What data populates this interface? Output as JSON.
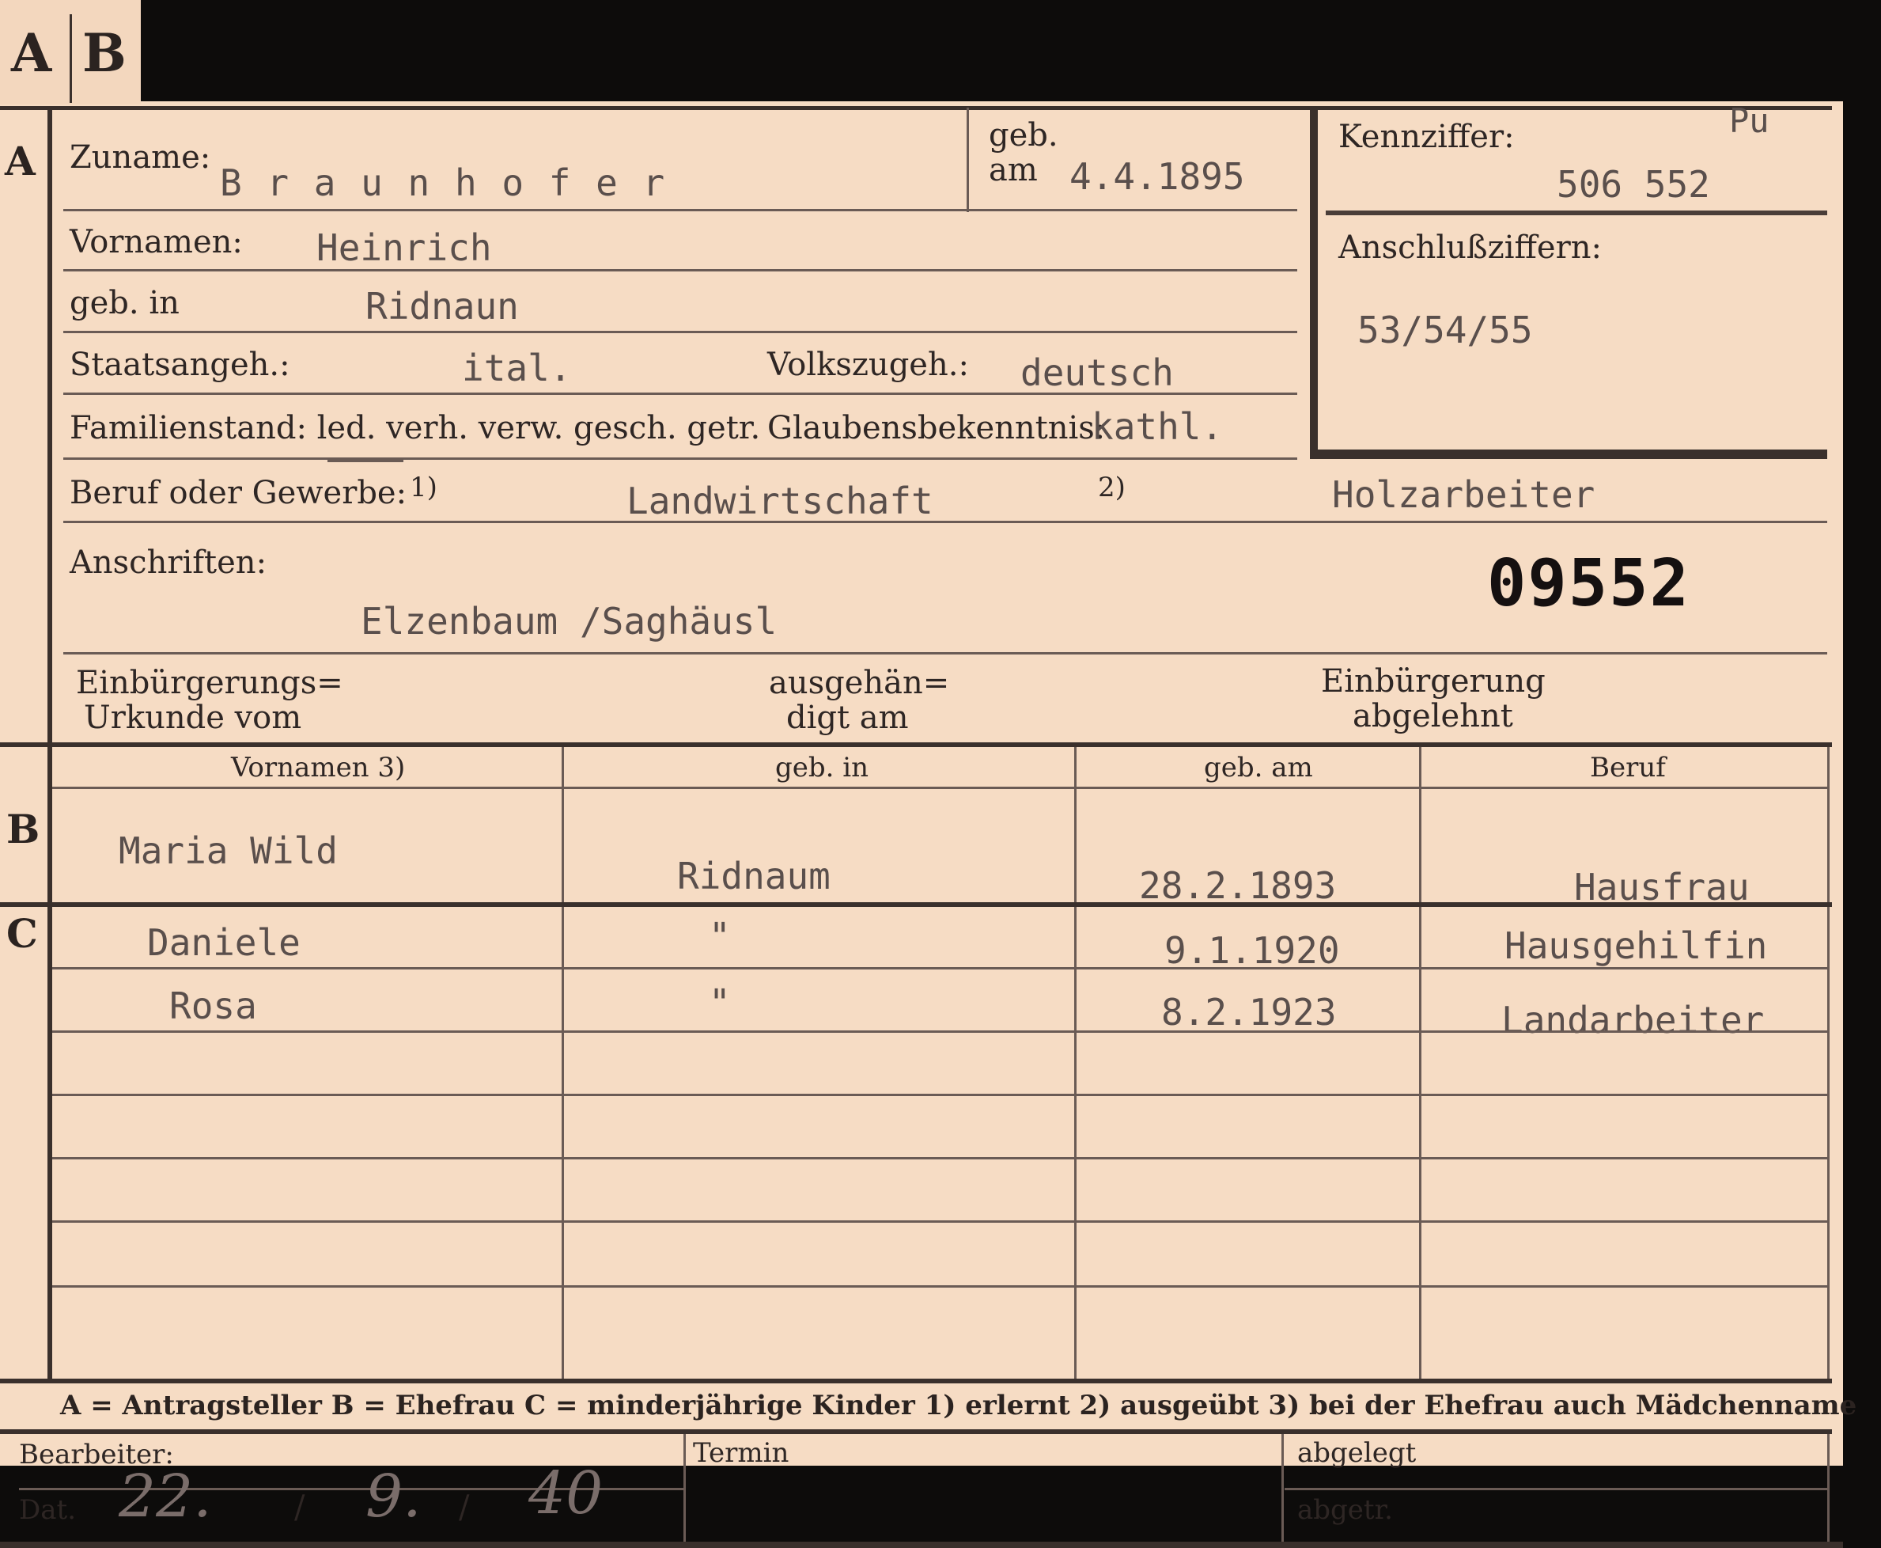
{
  "tabs": [
    "A",
    "B"
  ],
  "sections": {
    "a": "A",
    "b": "B",
    "c": "C"
  },
  "labels": {
    "surname": "Zuname:",
    "born_on_1": "geb.",
    "born_on_2": "am",
    "first_names": "Vornamen:",
    "born_in": "geb. in",
    "citizenship": "Staatsangeh.:",
    "ethnicity": "Volkszugeh.:",
    "marital": "Familienstand: led. verh. verw. gesch. getr.",
    "religion": "Glaubensbekenntnis:",
    "occupation": "Beruf oder Gewerbe:",
    "fn1": "1)",
    "fn2": "2)",
    "addresses": "Anschriften:",
    "naturalization_1": "Einbürgerungs=",
    "naturalization_2": "Urkunde vom",
    "handed_1": "ausgehän=",
    "handed_2": "digt am",
    "rejected_1": "Einbürgerung",
    "rejected_2": "abgelehnt",
    "code": "Kennziffer:",
    "linked": "Anschlußziffern:"
  },
  "values": {
    "surname": "B r a u n h o f e r",
    "birth_date": "4.4.1895",
    "first_names": "Heinrich",
    "birth_place": "Ridnaun",
    "citizenship": "ital.",
    "ethnicity": "deutsch",
    "religion": "kathl.",
    "occupation_learned": "Landwirtschaft",
    "occupation_practiced": "Holzarbeiter",
    "address": "Elzenbaum /Saghäusl",
    "code_note": "Pu",
    "code": "506 552",
    "linked": "53/54/55",
    "stamp": "09552"
  },
  "table": {
    "headers": [
      "Vornamen 3)",
      "geb. in",
      "geb. am",
      "Beruf"
    ],
    "wife": {
      "name": "Maria Wild",
      "place": "Ridnaum",
      "date": "28.2.1893",
      "job": "Hausfrau"
    },
    "children": [
      {
        "name": "Daniele",
        "place": "\"",
        "date": "9.1.1920",
        "job": "Hausgehilfin"
      },
      {
        "name": "Rosa",
        "place": "\"",
        "date": "8.2.1923",
        "job": "Landarbeiter"
      }
    ]
  },
  "legend": "A = Antragsteller   B = Ehefrau   C = minderjährige Kinder   1) erlernt   2) ausgeübt   3) bei der Ehefrau auch Mädchenname",
  "footer": {
    "clerk": "Bearbeiter:",
    "date_label": "Dat.",
    "date_day": "22.",
    "date_sep1": "/",
    "date_month": "9.",
    "date_sep2": "/",
    "date_year": "40",
    "deadline": "Termin",
    "filed": "abgelegt",
    "removed": "abgetr."
  }
}
